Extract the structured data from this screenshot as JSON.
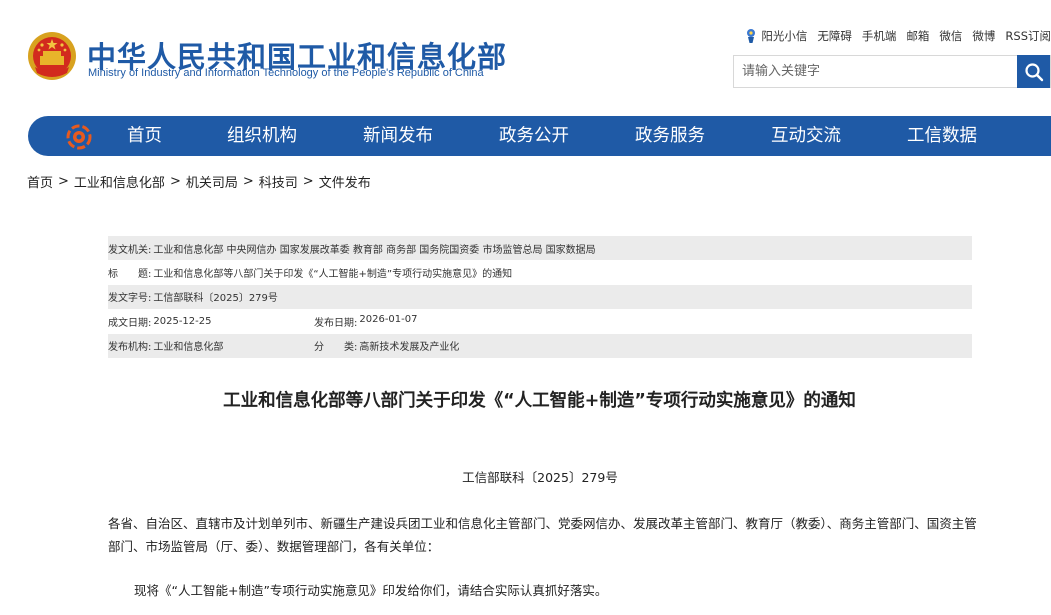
{
  "header": {
    "title_cn": "中华人民共和国工业和信息化部",
    "title_en": "Ministry of Industry and Information Technology of the People's Republic of China",
    "emblem_icon": "national-emblem-icon",
    "top_links": [
      "阳光小信",
      "无障碍",
      "手机端",
      "邮箱",
      "微信",
      "微博",
      "RSS订阅"
    ],
    "search_placeholder": "请输入关键字",
    "search_icon": "search-icon",
    "accent_color": "#1f5aa6"
  },
  "nav": {
    "logo_icon": "ministry-logo-icon",
    "items": [
      "首页",
      "组织机构",
      "新闻发布",
      "政务公开",
      "政务服务",
      "互动交流",
      "工信数据"
    ]
  },
  "breadcrumb": [
    "首页",
    "工业和信息化部",
    "机关司局",
    "科技司",
    "文件发布"
  ],
  "breadcrumb_separator": ">",
  "meta": {
    "issuer_label": "发文机关:",
    "issuer_value": "工业和信息化部 中央网信办 国家发展改革委 教育部 商务部 国务院国资委 市场监管总局 国家数据局",
    "title_label": "标　　题:",
    "title_value": "工业和信息化部等八部门关于印发《“人工智能+制造”专项行动实施意见》的通知",
    "docno_label": "发文字号:",
    "docno_value": "工信部联科〔2025〕279号",
    "date_label": "成文日期:",
    "date_value": "2025-12-25",
    "pubdate_label": "发布日期:",
    "pubdate_value": "2026-01-07",
    "org_label": "发布机构:",
    "org_value": "工业和信息化部",
    "category_label": "分　　类:",
    "category_value": "高新技术发展及产业化"
  },
  "document": {
    "title": "工业和信息化部等八部门关于印发《“人工智能+制造”专项行动实施意见》的通知",
    "number": "工信部联科〔2025〕279号",
    "recipients": "各省、自治区、直辖市及计划单列市、新疆生产建设兵团工业和信息化主管部门、党委网信办、发展改革主管部门、教育厅（教委）、商务主管部门、国资主管部门、市场监管局（厅、委）、数据管理部门，各有关单位：",
    "body_first_line": "现将《“人工智能+制造”专项行动实施意见》印发给你们，请结合实际认真抓好落实。"
  }
}
